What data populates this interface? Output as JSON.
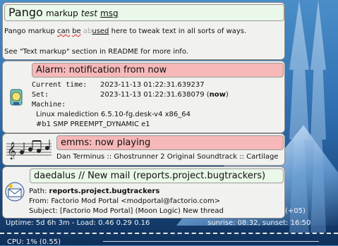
{
  "pango": {
    "title_big": "Pango",
    "title_markup": "markup",
    "title_test": "test",
    "title_msg": "msg",
    "body_prefix": "Pango markup ",
    "body_can": "can",
    "body_be": "be",
    "body_ab": "ab",
    "body_used": "used",
    "body_suffix": " here to tweak text in all sorts of ways.",
    "body_line2": "See \"Text markup\" section in README for more info."
  },
  "alarm": {
    "title": "Alarm: notification from now",
    "current_label": "Current time:",
    "current_value": "2023-11-13 01:22:31.639237",
    "set_label": "Set:",
    "set_value": "2023-11-13 01:22:31.638079 (",
    "set_now": "now",
    "set_close": ")",
    "machine_label": "Machine:",
    "machine_line1": "Linux malediction 6.5.10-fg.desk-v4 x86_64",
    "machine_line2": "#b1 SMP PREEMPT_DYNAMIC e1"
  },
  "emms": {
    "title": "emms: now playing",
    "track": "Dan Terminus :: Ghostrunner 2 Original Soundtrack :: Cartilage"
  },
  "mail": {
    "title": "daedalus // New mail (reports.project.bugtrackers)",
    "path_label": "Path: ",
    "path_value": "reports.project.bugtrackers",
    "from": "From: Factorio Mod Portal <modportal@factorio.com>",
    "subject": "Subject: [Factorio Mod Portal] (Moon Logic) New thread"
  },
  "desktop": {
    "side_count": "(+05)",
    "uptime": "Uptime: 5d 6h 3m - Load: 0.46 0.29 0.16",
    "sun": "sunrise: 08:32, sunset: 16:50",
    "cpu": "CPU: 1% (0.55)"
  }
}
